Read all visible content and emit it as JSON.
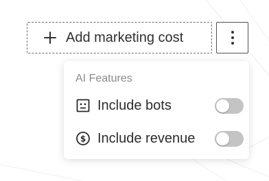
{
  "toolbar": {
    "add_button_label": "Add marketing cost",
    "add_icon": "plus-icon",
    "more_icon": "vertical-ellipsis-icon"
  },
  "menu": {
    "heading": "AI Features",
    "items": [
      {
        "label": "Include bots",
        "icon": "robot-face-icon",
        "enabled": false
      },
      {
        "label": "Include revenue",
        "icon": "dollar-circle-icon",
        "enabled": false
      }
    ]
  },
  "colors": {
    "toggle_off": "#c4c4c4",
    "heading": "#8a8a8a",
    "text": "#2b2b2b"
  }
}
